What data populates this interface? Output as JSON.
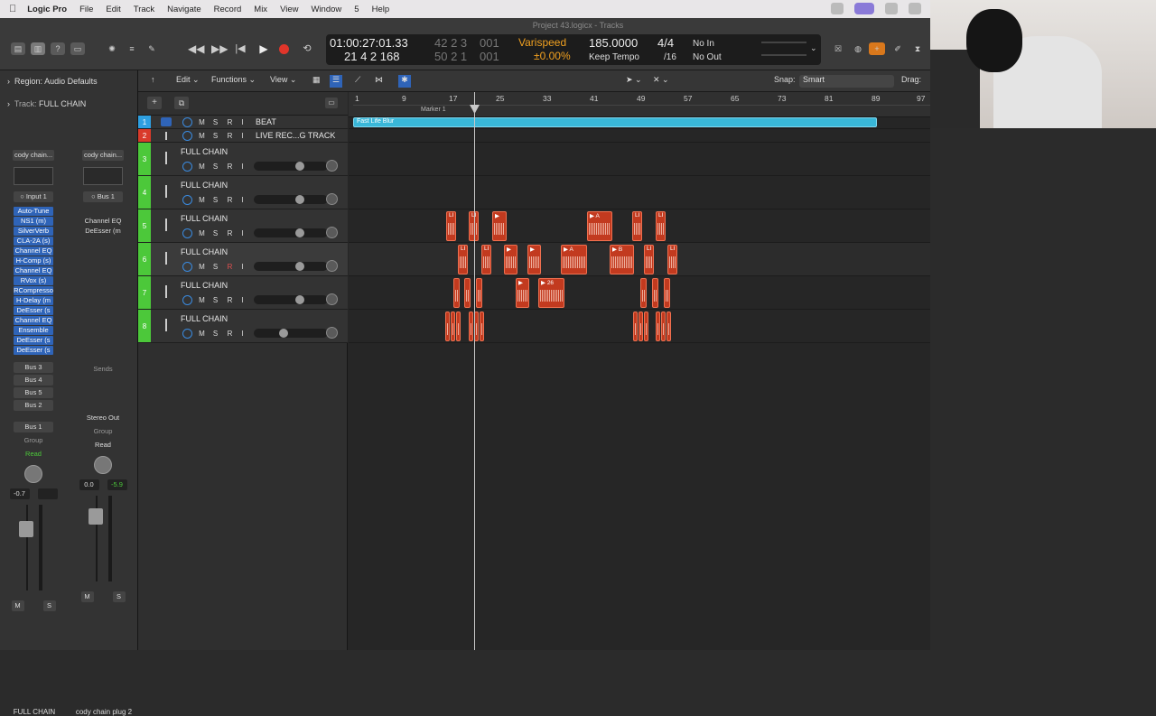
{
  "menubar": {
    "app": "Logic Pro",
    "items": [
      "File",
      "Edit",
      "Track",
      "Navigate",
      "Record",
      "Mix",
      "View",
      "Window",
      "5",
      "Help"
    ]
  },
  "window_title": "Project 43.logicx - Tracks",
  "lcd": {
    "time": "01:00:27:01.33",
    "bars_top": "42 2 3",
    "ticks_top": "001",
    "bars_bottom": "21 4 2 168",
    "bars_bottom2": "50 2 1",
    "ticks_bottom": "001",
    "varispeed": "Varispeed",
    "varispeed_value": "±0.00%",
    "tempo": "185.0000",
    "tempo_mode": "Keep Tempo",
    "signature": "4/4",
    "division": "/16",
    "in": "No In",
    "out": "No Out"
  },
  "inspector": {
    "region_label": "Region:",
    "region_value": "Audio Defaults",
    "track_label": "Track:",
    "track_value": "FULL CHAIN",
    "strip1": {
      "setting": "cody chain...",
      "input": "Input 1",
      "plugins": [
        "Auto-Tune",
        "NS1 (m)",
        "SilverVerb",
        "CLA-2A (s)",
        "Channel EQ",
        "H-Comp (s)",
        "Channel EQ",
        "RVox (s)",
        "RCompresso",
        "H-Delay (m",
        "DeEsser (s",
        "Channel EQ",
        "Ensemble",
        "DeEsser (s",
        "DeEsser (s"
      ],
      "sends": [
        "Bus 3",
        "Bus 4",
        "Bus 5",
        "Bus 2"
      ],
      "output": "Bus 1",
      "group": "Group",
      "automation": "Read",
      "volume": "-0.7",
      "mute": "M",
      "solo": "S",
      "name": "FULL CHAIN"
    },
    "strip2": {
      "setting": "cody chain...",
      "input": "Bus 1",
      "plugins": [
        "Channel EQ",
        "DeEsser (m"
      ],
      "sends_label": "Sends",
      "output": "Stereo Out",
      "group": "Group",
      "automation": "Read",
      "volume": "0.0",
      "peak": "-5.9",
      "mute": "M",
      "solo": "S",
      "name": "cody chain plug 2"
    }
  },
  "main_menu": {
    "edit": "Edit",
    "functions": "Functions",
    "view": "View",
    "snap_label": "Snap:",
    "snap_value": "Smart",
    "drag_label": "Drag:"
  },
  "ruler": {
    "bars": [
      "1",
      "9",
      "17",
      "25",
      "33",
      "41",
      "49",
      "57",
      "65",
      "73",
      "81",
      "89",
      "97"
    ],
    "marker": "Marker 1"
  },
  "tracks": [
    {
      "num": "1",
      "name": "BEAT",
      "color": "#2e9fe0"
    },
    {
      "num": "2",
      "name": "LIVE REC...G TRACK",
      "color": "#d93a2a"
    },
    {
      "num": "3",
      "name": "FULL CHAIN",
      "color": "#4cc83a"
    },
    {
      "num": "4",
      "name": "FULL CHAIN",
      "color": "#4cc83a"
    },
    {
      "num": "5",
      "name": "FULL CHAIN",
      "color": "#4cc83a"
    },
    {
      "num": "6",
      "name": "FULL CHAIN",
      "color": "#4cc83a"
    },
    {
      "num": "7",
      "name": "FULL CHAIN",
      "color": "#4cc83a"
    },
    {
      "num": "8",
      "name": "FULL CHAIN",
      "color": "#4cc83a"
    }
  ],
  "beat_region": "Fast Life Blur",
  "button_labels": {
    "m": "M",
    "s": "S",
    "r": "R",
    "i": "I"
  },
  "region_labels": {
    "a": "A",
    "b": "B",
    "num": "26",
    "li": "LI"
  }
}
